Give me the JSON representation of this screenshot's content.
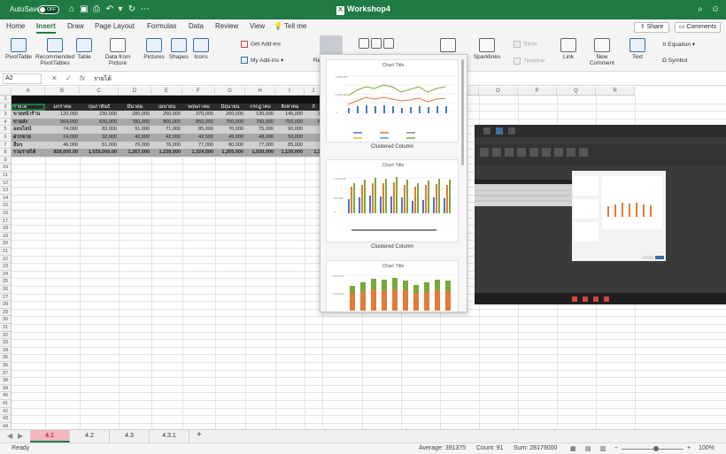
{
  "titlebar": {
    "autosave_label": "AutoSave",
    "autosave_state": "OFF",
    "doc_title": "Workshop4",
    "brand_color": "#1f7a44"
  },
  "tabs": [
    "Home",
    "Insert",
    "Draw",
    "Page Layout",
    "Formulas",
    "Data",
    "Review",
    "View",
    "Tell me"
  ],
  "active_tab": "Insert",
  "share_label": "Share",
  "comments_label": "Comments",
  "ribbon": {
    "pivot": "PivotTable",
    "recommended_1": "Recommended",
    "recommended_2": "PivotTables",
    "table": "Table",
    "data_from_1": "Data from",
    "data_from_2": "Picture",
    "pictures": "Pictures",
    "shapes": "Shapes",
    "icons": "Icons",
    "get_addins": "Get Add-ins",
    "my_addins": "My Add-ins",
    "re": "Re",
    "sparklines": "Sparklines",
    "slicer": "Slicer",
    "timeline": "Timeline",
    "link": "Link",
    "new_comment_1": "New",
    "new_comment_2": "Comment",
    "text": "Text",
    "equation": "Equation",
    "symbol": "Symbol"
  },
  "formula": {
    "namebox": "A2",
    "fx": "fx",
    "value": "รายได้"
  },
  "columns": [
    "A",
    "B",
    "C",
    "D",
    "E",
    "F",
    "G",
    "H",
    "I",
    "J",
    "K",
    "L",
    "M",
    "N",
    "O",
    "P",
    "Q",
    "R"
  ],
  "table": {
    "headers": [
      "รายได้",
      "มกราคม",
      "กุมภาพันธ์",
      "มีนาคม",
      "เมษายน",
      "พฤษภาคม",
      "มิถุนายน",
      "กรกฎาคม",
      "สิงหาคม",
      "กั"
    ],
    "rows": [
      {
        "label": "ขายหน้าร้าน",
        "values": [
          "120,000",
          "230,000",
          "280,000",
          "250,000",
          "270,000",
          "260,000",
          "130,000",
          "145,000",
          "3"
        ]
      },
      {
        "label": "ขายส่ง",
        "values": [
          "564,000",
          "630,000",
          "780,000",
          "800,000",
          "850,000",
          "750,000",
          "700,000",
          "760,000",
          "8"
        ]
      },
      {
        "label": "ออนไลน์",
        "values": [
          "74,000",
          "82,000",
          "91,000",
          "71,000",
          "85,000",
          "70,000",
          "75,000",
          "90,000",
          ""
        ]
      },
      {
        "label": "ฝากขาย",
        "values": [
          "24,000",
          "32,000",
          "40,000",
          "42,000",
          "42,500",
          "45,000",
          "48,000",
          "50,000",
          ""
        ]
      },
      {
        "label": "อื่นๆ",
        "values": [
          "46,000",
          "51,000",
          "76,000",
          "76,000",
          "77,000",
          "80,000",
          "77,000",
          "85,000",
          ""
        ]
      },
      {
        "label": "รวมรายได้",
        "values": [
          "828,000.00",
          "1,025,000.00",
          "1,267,000",
          "1,239,000",
          "1,324,500",
          "1,205,000",
          "1,030,000",
          "1,130,000",
          "1,3"
        ]
      }
    ]
  },
  "chart_menu": {
    "items": [
      {
        "title": "Chart Title",
        "caption": "Clustered Column"
      },
      {
        "title": "Chart Title",
        "caption": "Clustered Column"
      },
      {
        "title": "Chart Title",
        "caption": ""
      }
    ]
  },
  "sheets": [
    "4.1",
    "4.2",
    "4.3",
    "4.3.1"
  ],
  "active_sheet": "4.1",
  "status": {
    "ready": "Ready",
    "average": "Average: 391375",
    "count": "Count: 91",
    "sum": "Sum: 28179000",
    "zoom": "100%"
  }
}
